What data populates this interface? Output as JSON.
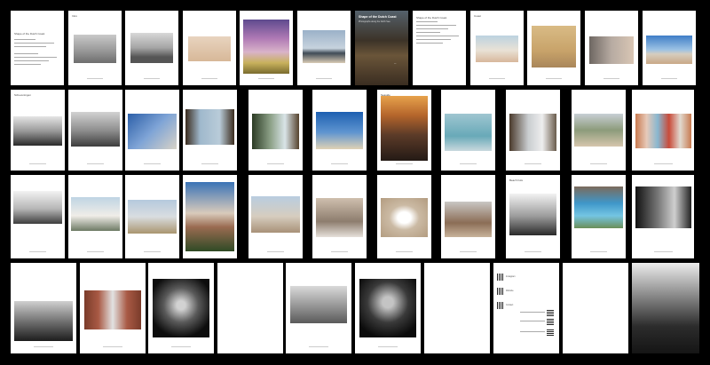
{
  "title_page": {
    "heading": "Shape of the Dutch Coast",
    "subheading": "Photographs along the North Sea",
    "credit": "—"
  },
  "section_labels": {
    "row1_p2": "Intro",
    "row1_p9": "Coast",
    "row2_p1": "Scheveningen",
    "row2_p7": "Seaside",
    "row3_p9": "Beach huts"
  },
  "qr_page": {
    "line1": "Instagram",
    "line2": "Website",
    "line3": "Contact"
  },
  "colors": {
    "background": "#000000",
    "page": "#ffffff"
  }
}
